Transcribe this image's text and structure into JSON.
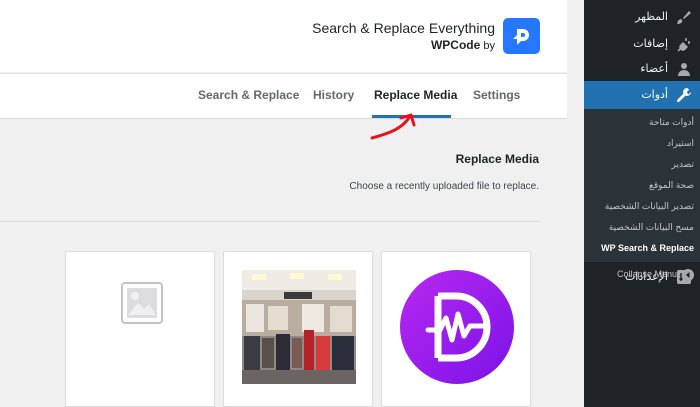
{
  "plugin": {
    "title": "Search & Replace Everything",
    "by_prefix": "by",
    "by_brand": "WPCode",
    "logo_icon": "wpcode-logo-icon",
    "logo_color": "#2677ff"
  },
  "tabs": [
    {
      "label": "Search & Replace",
      "active": false
    },
    {
      "label": "History",
      "active": false
    },
    {
      "label": "Replace Media",
      "active": true
    },
    {
      "label": "Settings",
      "active": false
    }
  ],
  "section": {
    "title": "Replace Media",
    "description": "Choose a recently uploaded file to replace."
  },
  "media_cards": [
    {
      "kind": "placeholder",
      "icon": "image-placeholder-icon"
    },
    {
      "kind": "photo",
      "icon": "clothing-store-photo"
    },
    {
      "kind": "logo",
      "icon": "divi-logo-icon",
      "color": "#8c1ff0"
    }
  ],
  "sidebar": {
    "items": [
      {
        "label": "المظهر",
        "icon": "paintbrush-icon"
      },
      {
        "label": "إضافات",
        "icon": "plugin-icon"
      },
      {
        "label": "أعضاء",
        "icon": "users-icon"
      },
      {
        "label": "أدوات",
        "icon": "wrench-icon",
        "active": true
      },
      {
        "label": "الإعدادات",
        "icon": "settings-icon"
      }
    ],
    "submenu": [
      {
        "label": "أدوات متاحة"
      },
      {
        "label": "استيراد"
      },
      {
        "label": "تصدير"
      },
      {
        "label": "صحة الموقع"
      },
      {
        "label": "تصدير البيانات الشخصية"
      },
      {
        "label": "مسح البيانات الشخصية"
      },
      {
        "label": "WP Search & Replace",
        "current": true
      }
    ],
    "collapse_label": "Collapse Menu",
    "accent_color": "#2271b1",
    "bg_color": "#1d2327"
  },
  "annotation": {
    "icon": "red-arrow-annotation",
    "color": "#e8121b"
  }
}
